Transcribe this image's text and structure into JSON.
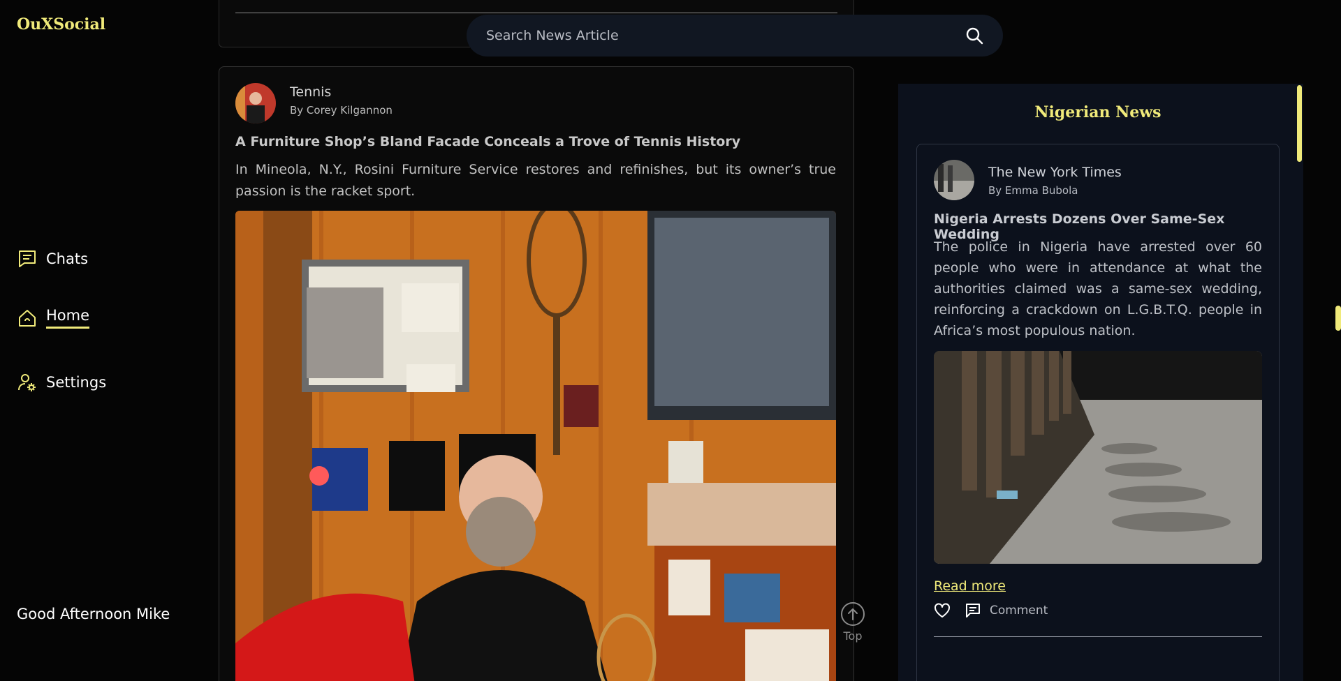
{
  "app": {
    "logo": "OuXSocial"
  },
  "sidebar": {
    "items": [
      {
        "label": "Chats",
        "icon": "chat-icon"
      },
      {
        "label": "Home",
        "icon": "home-icon",
        "active": true
      },
      {
        "label": "Settings",
        "icon": "user-settings-icon"
      }
    ],
    "greeting": "Good Afternoon Mike"
  },
  "search": {
    "placeholder": "Search News Article",
    "icon": "search-icon"
  },
  "feed": {
    "post": {
      "category": "Tennis",
      "author": "By Corey Kilgannon",
      "title": "A Furniture Shop’s Bland Facade Conceals a Trove of Tennis History",
      "description": "In Mineola, N.Y., Rosini Furniture Service restores and refinishes, but its owner’s true passion is the racket sport."
    },
    "top_label": "Top"
  },
  "panel": {
    "title": "Nigerian News",
    "card": {
      "source": "The New York Times",
      "author": "By Emma Bubola",
      "title": "Nigeria Arrests Dozens Over Same-Sex Wedding",
      "description": "The police in Nigeria have arrested over 60 people who were in attendance at what the authorities claimed was a same-sex wedding, reinforcing a crackdown on L.G.B.T.Q. people in Africa’s most populous nation.",
      "read_more": "Read more",
      "comment_label": "Comment"
    }
  },
  "colors": {
    "accent": "#f0ea7a",
    "background": "#050505",
    "panel": "#0c111c"
  }
}
